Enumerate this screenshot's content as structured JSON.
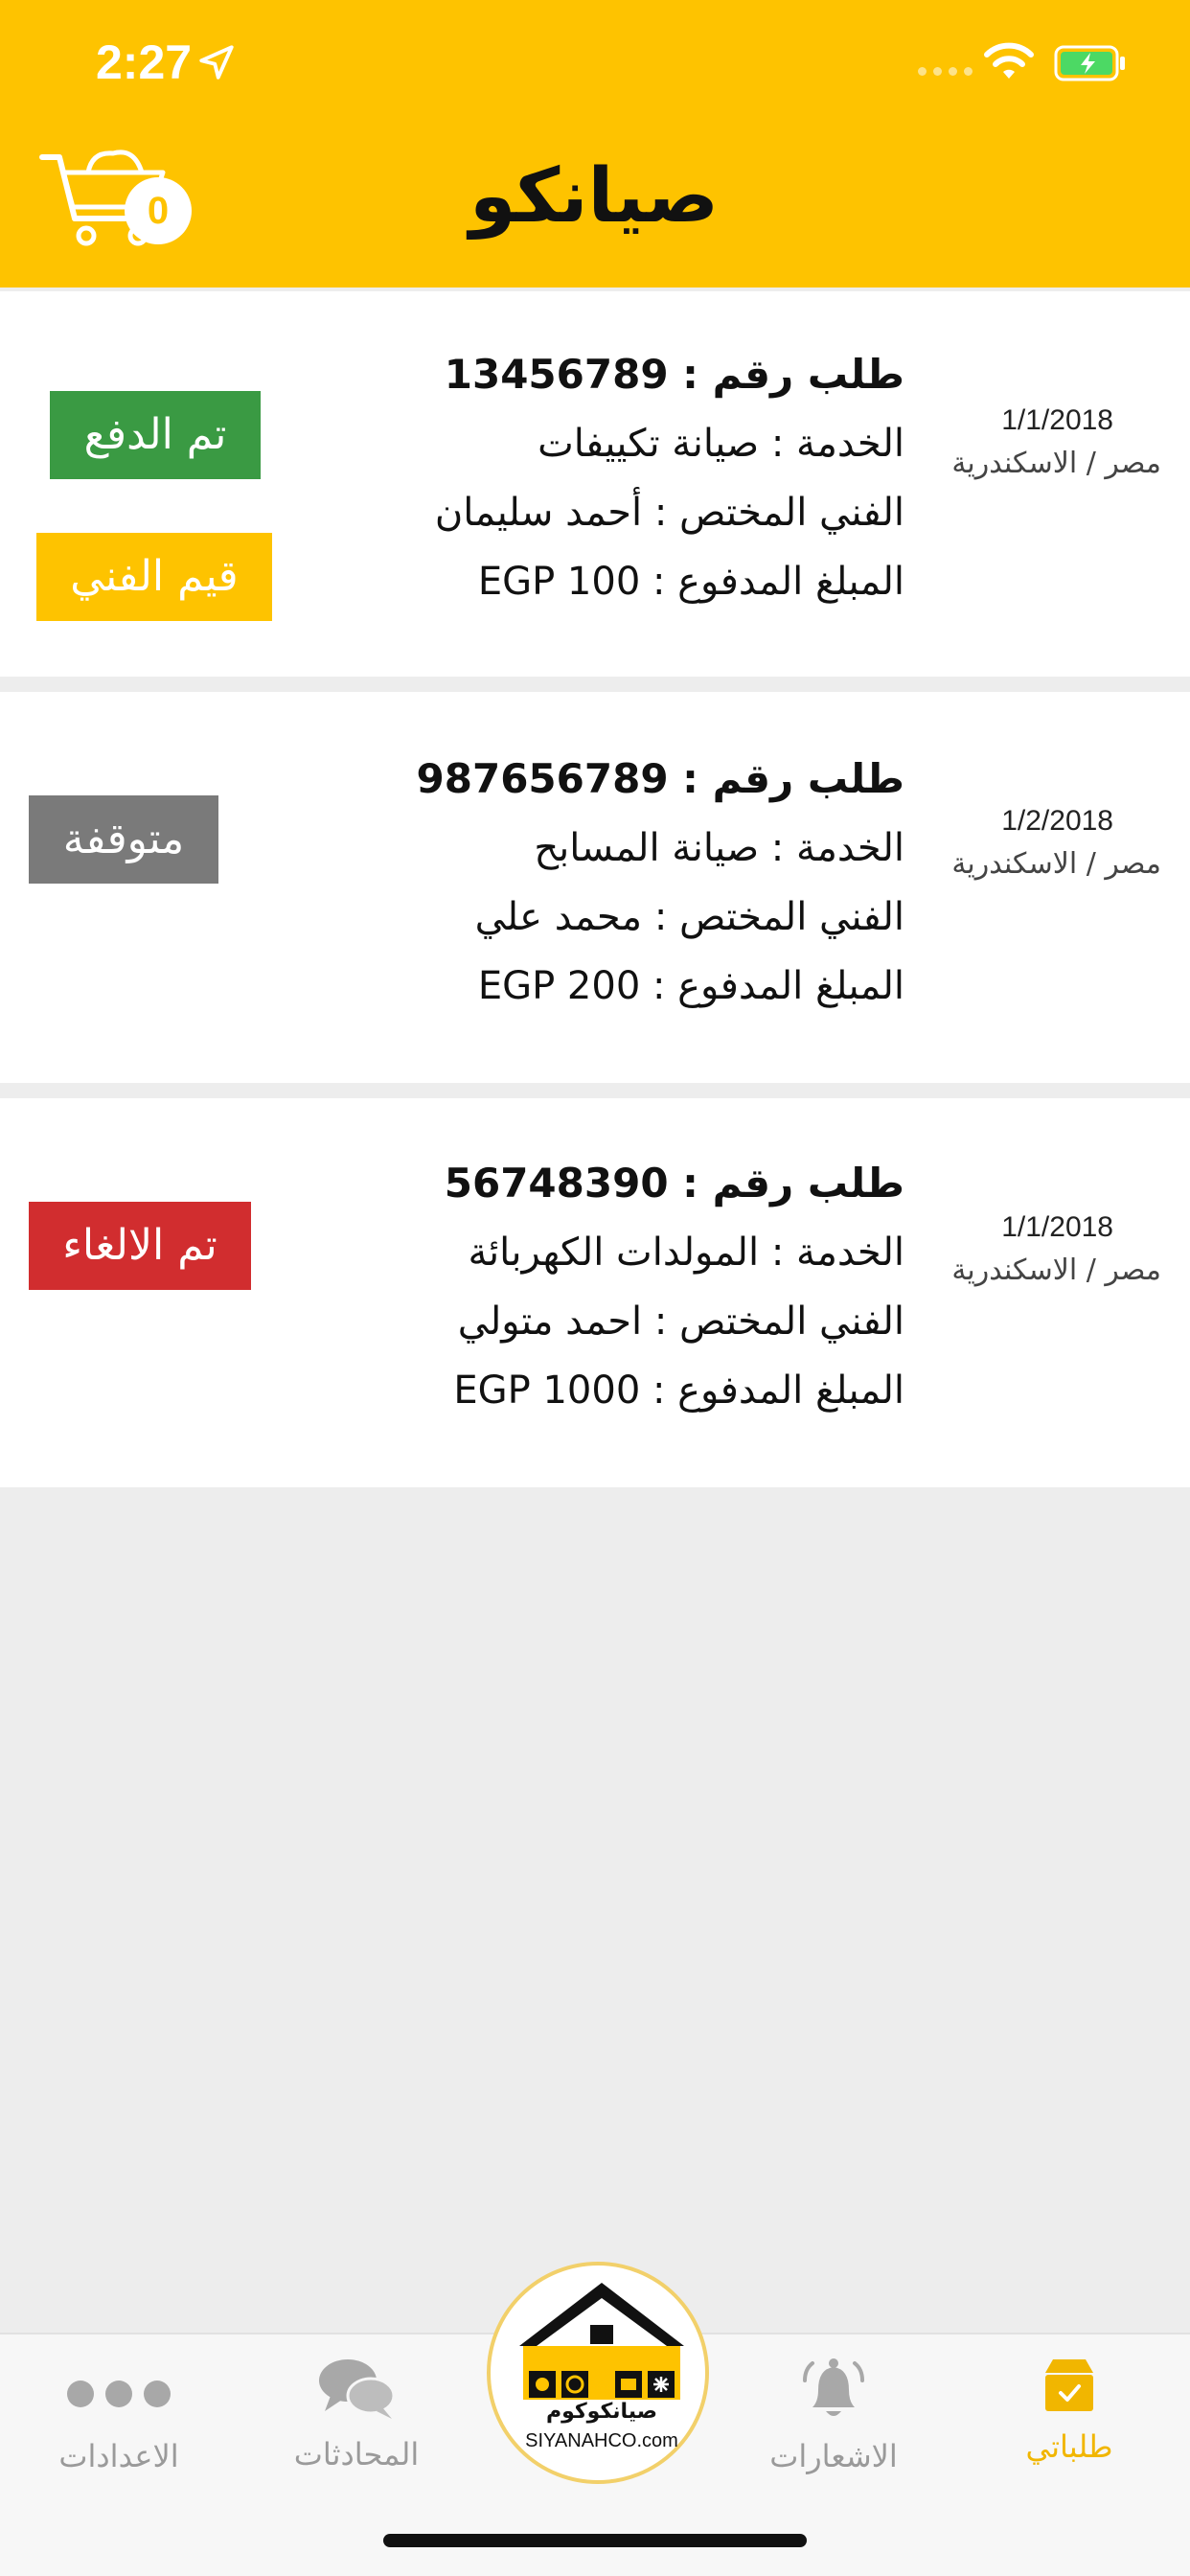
{
  "status_bar": {
    "time": "2:27"
  },
  "header": {
    "title": "صيانكو",
    "cart_count": "0"
  },
  "orders": [
    {
      "date": "1/1/2018",
      "location": "مصر / الاسكندرية",
      "number_line": "طلب رقم : 13456789",
      "service_line": "الخدمة : صيانة تكييفات",
      "technician_line": "الفني المختص : أحمد سليمان",
      "amount_line": "المبلغ المدفوع : EGP 100",
      "status_label": "تم الدفع",
      "action_label": "قيم الفني"
    },
    {
      "date": "1/2/2018",
      "location": "مصر / الاسكندرية",
      "number_line": "طلب رقم : 987656789",
      "service_line": "الخدمة : صيانة المسابح",
      "technician_line": "الفني المختص : محمد علي",
      "amount_line": "المبلغ المدفوع : EGP 200",
      "status_label": "متوقفة"
    },
    {
      "date": "1/1/2018",
      "location": "مصر / الاسكندرية",
      "number_line": "طلب رقم : 56748390",
      "service_line": "الخدمة : المولدات الكهربائة",
      "technician_line": "الفني المختص : احمد متولي",
      "amount_line": "المبلغ المدفوع : EGP 1000",
      "status_label": "تم الالغاء"
    }
  ],
  "bottom_nav": {
    "orders": "طلباتي",
    "notifications": "الاشعارات",
    "chats": "المحادثات",
    "settings": "الاعدادات",
    "logo_ar": "صيانكوكوم",
    "logo_en": "SIYANAHCO.com"
  },
  "colors": {
    "brand": "#fec300",
    "paid": "#3a9a43",
    "stopped": "#7a7a7a",
    "cancelled": "#d12d2f"
  }
}
